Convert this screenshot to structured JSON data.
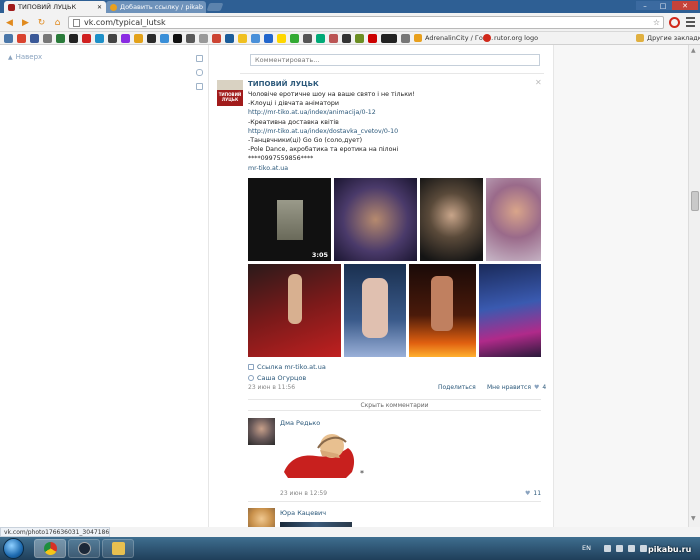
{
  "browser": {
    "tabs": [
      {
        "label": "ТИПОВИЙ ЛУЦЬК",
        "active": true
      },
      {
        "label": "Добавить ссылку / pikab",
        "active": false
      }
    ],
    "url": "vk.com/typical_lutsk",
    "bookmarks": {
      "adrenalin": "AdrenalinCity / Гол...",
      "rutor": "rutor.org logo",
      "other": "Другие закладки"
    },
    "status_url": "vk.com/photo176636031_304718610"
  },
  "sidebar": {
    "up_label": "Наверх"
  },
  "wall": {
    "comment_placeholder": "Комментировать...",
    "post": {
      "author": "ТИПОВИЙ ЛУЦЬК",
      "avatar_text": "ТИПОВИЙ ЛУЦЬК",
      "lines": [
        {
          "text": "Чоловіче еротичне шоу на ваше свято і не тільки!",
          "link": false
        },
        {
          "text": "-Клоуці і дівчата аніматори",
          "link": false
        },
        {
          "text": "http://mr-tiko.at.ua/index/animacija/0-12",
          "link": true
        },
        {
          "text": "-Креативна доставка квітів",
          "link": false
        },
        {
          "text": "http://mr-tiko.at.ua/index/dostavka_cvetov/0-10",
          "link": true
        },
        {
          "text": "-Танцвчники(ці) Go Go (соло,дует)",
          "link": false
        },
        {
          "text": "-Pole Dance, акробатика та еротика на пілоні",
          "link": false
        },
        {
          "text": "****0997559856****",
          "link": false
        },
        {
          "text": "mr-tiko.at.ua",
          "link": true
        }
      ],
      "video_duration": "3:05",
      "attachment_link": "Ссылка mr-tiko.at.ua",
      "attachment_user": "Саша Огурцов",
      "date": "23 июн в 11:56",
      "share_label": "Поделиться",
      "like_label": "Мне нравится",
      "like_count": "4"
    },
    "hide_comments_label": "Скрыть комментарии",
    "comments": [
      {
        "author": "Дма Редько",
        "date": "23 июн в 12:59",
        "likes": "11"
      },
      {
        "author": "Юра Кацевич"
      }
    ]
  },
  "taskbar": {
    "lang": "EN",
    "watermark": "pikabu.ru"
  },
  "colors": {
    "vk_link": "#2b587a",
    "chrome_blue": "#2e5f94",
    "taskbar": "#1f3f5a"
  }
}
